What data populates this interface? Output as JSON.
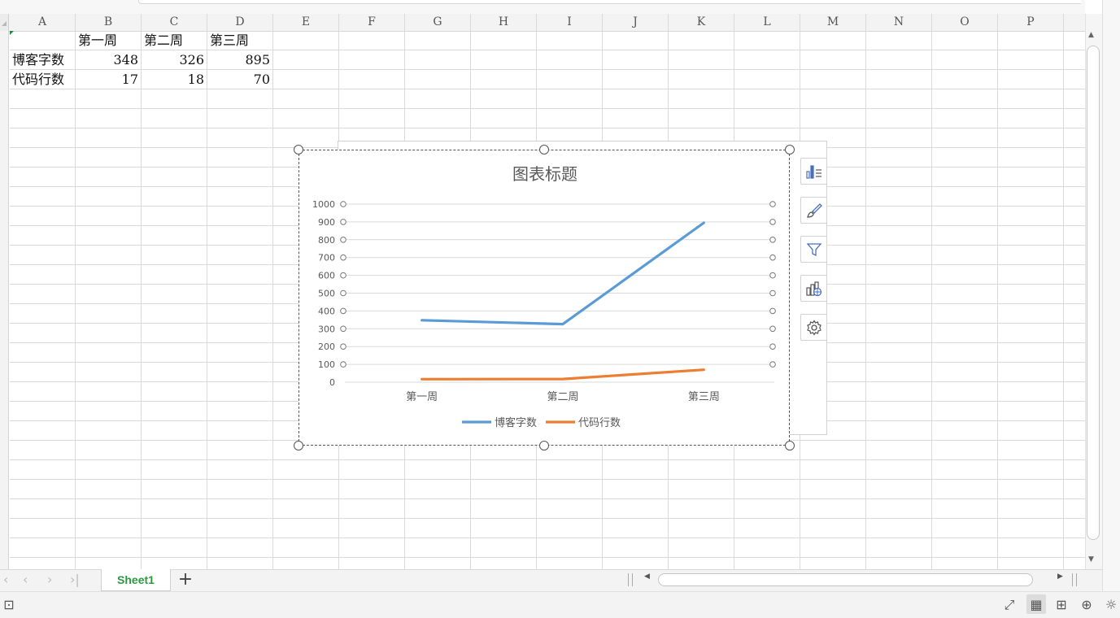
{
  "columns": [
    "A",
    "B",
    "C",
    "D",
    "E",
    "F",
    "G",
    "H",
    "I",
    "J",
    "K",
    "L",
    "M",
    "N",
    "O",
    "P"
  ],
  "cells": {
    "r1": [
      "",
      "第一周",
      "第二周",
      "第三周"
    ],
    "r2": [
      "博客字数",
      "348",
      "326",
      "895"
    ],
    "r3": [
      "代码行数",
      "17",
      "18",
      "70"
    ]
  },
  "sheet": {
    "active_tab": "Sheet1",
    "add_label": "+"
  },
  "chart_data": {
    "type": "line",
    "title": "图表标题",
    "categories": [
      "第一周",
      "第二周",
      "第三周"
    ],
    "series": [
      {
        "name": "博客字数",
        "values": [
          348,
          326,
          895
        ],
        "color": "#5b9bd5"
      },
      {
        "name": "代码行数",
        "values": [
          17,
          18,
          70
        ],
        "color": "#ed7d31"
      }
    ],
    "ylim": [
      0,
      1000
    ],
    "yticks": [
      "0",
      "100",
      "200",
      "300",
      "400",
      "500",
      "600",
      "700",
      "800",
      "900",
      "1000"
    ],
    "grid": true,
    "legend": "bottom"
  },
  "chart_tools": [
    "chart-elements-icon",
    "chart-style-icon",
    "chart-filter-icon",
    "chart-online-icon",
    "chart-settings-icon"
  ],
  "status": {
    "view": "normal"
  }
}
